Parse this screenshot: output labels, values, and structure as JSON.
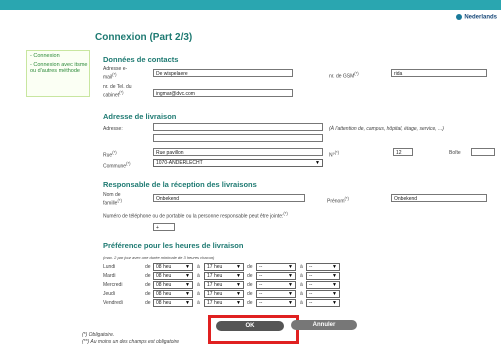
{
  "header": {
    "language_link": "Nederlands"
  },
  "sidebar": {
    "items": [
      {
        "label": "Connexion"
      },
      {
        "label": "Connexion avec itsme ou d'autres méthode"
      }
    ]
  },
  "page": {
    "title": "Connexion (Part 2/3)"
  },
  "contact": {
    "heading": "Données de contacts",
    "email_label": "Adresse e-mail",
    "email_value": "De wispelaere",
    "gsm_label": "nr. de GSM",
    "gsm_value": "rida",
    "tel_label": "nr. de Tel. du cabinet",
    "tel_value": "ingmar@dvc.com",
    "req": "(*)"
  },
  "delivery": {
    "heading": "Adresse de livraison",
    "address_label": "Adresse:",
    "address_value": "",
    "address_hint": "(À l'attention de, campus, hôpital, étage, service, ...)",
    "street_label": "Rue",
    "street_value": "Rue pavillon",
    "number_label": "N°",
    "number_value": "12",
    "box_label": "Boîte",
    "box_value": "",
    "commune_label": "Commune",
    "commune_value": "1070-ANDERLECHT",
    "req": "(*)"
  },
  "responsible": {
    "heading": "Responsable de la réception des livraisons",
    "lastname_label": "Nom de famille",
    "lastname_value": "Onbekend",
    "firstname_label": "Prénom",
    "firstname_value": "Onbekend",
    "phone_label": "Numéro de téléphone ou de portable ou la personne responsable peut être jointe:",
    "phone_value": "+",
    "req": "(*)"
  },
  "hours": {
    "heading": "Préférence pour les heures de livraison",
    "note": "(max. 2 par jour avec une durée minimale de 3 heures chacun)",
    "de": "de",
    "a": "à",
    "days": [
      {
        "day": "Lundi",
        "from1": "08 heu",
        "to1": "17 heu",
        "from2": "--",
        "to2": "--"
      },
      {
        "day": "Mardi",
        "from1": "08 heu",
        "to1": "17 heu",
        "from2": "--",
        "to2": "--"
      },
      {
        "day": "Mercredi",
        "from1": "08 heu",
        "to1": "17 heu",
        "from2": "--",
        "to2": "--"
      },
      {
        "day": "Jeudi",
        "from1": "08 heu",
        "to1": "17 heu",
        "from2": "--",
        "to2": "--"
      },
      {
        "day": "Vendredi",
        "from1": "08 heu",
        "to1": "17 heu",
        "from2": "--",
        "to2": "--"
      }
    ]
  },
  "actions": {
    "ok_label": "OK",
    "cancel_label": "Annuler"
  },
  "footer": {
    "required_note": "(*) Obligatoire.",
    "one_field_note": "(**) Au moins un des champs est obligatoire"
  }
}
